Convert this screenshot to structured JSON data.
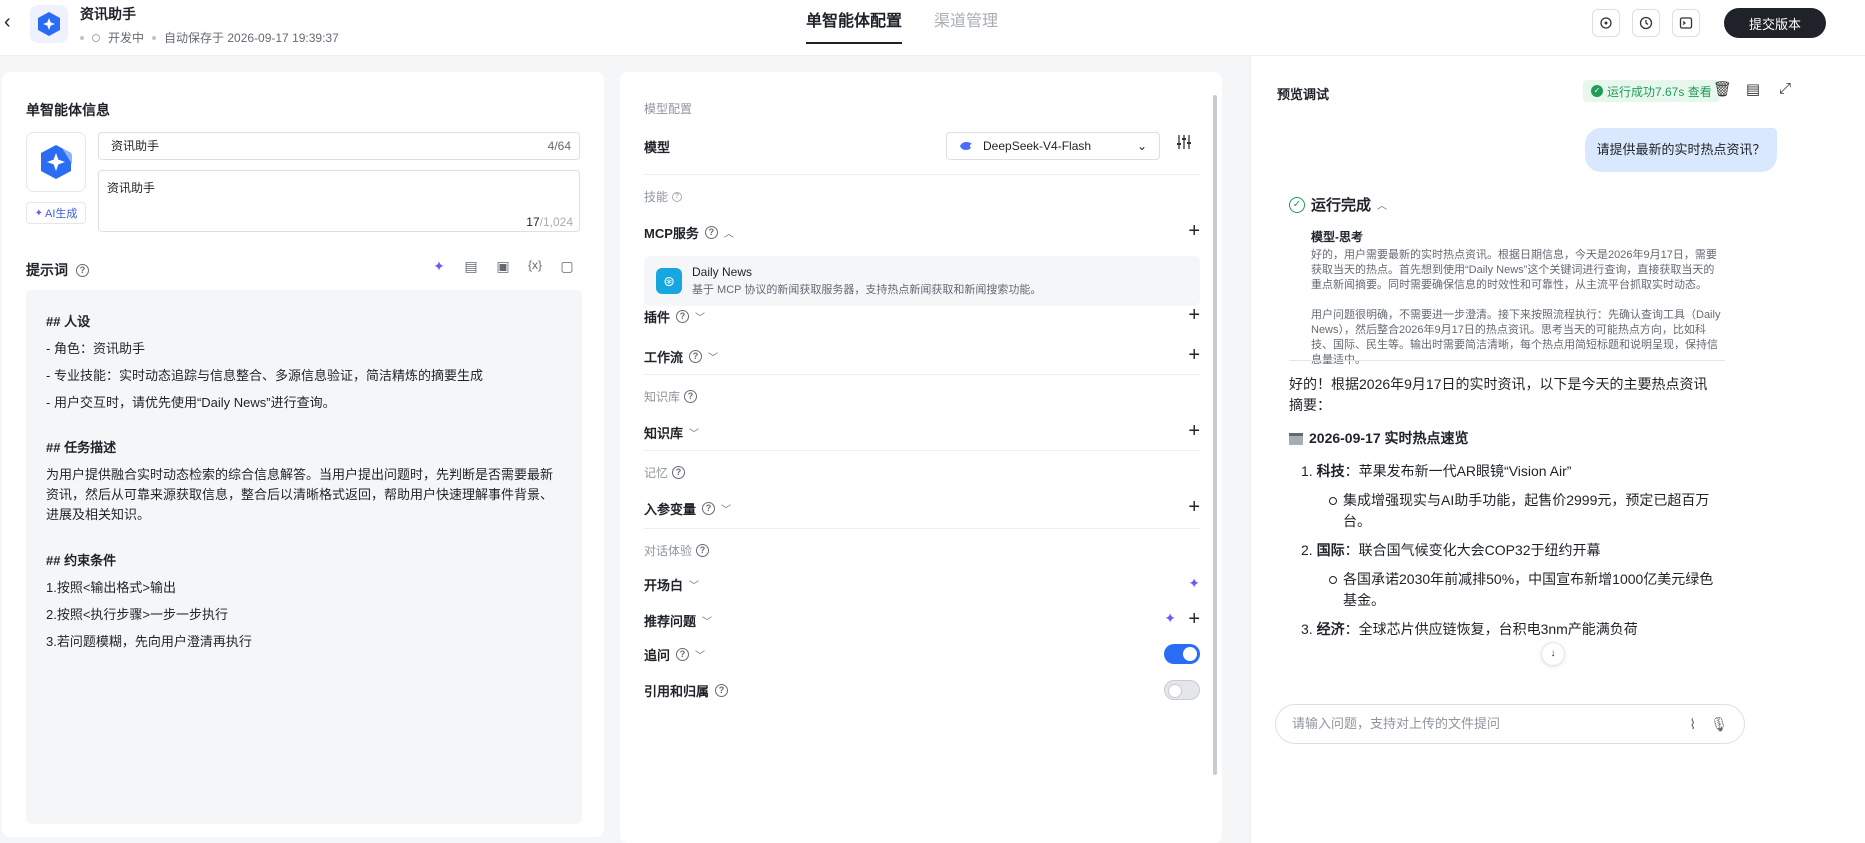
{
  "header": {
    "back_icon": "chevron-left-icon",
    "app_title": "资讯助手",
    "status": "开发中",
    "autosave": "自动保存于 2026-09-17 19:39:37",
    "tabs": [
      {
        "label": "单智能体配置",
        "active": true
      },
      {
        "label": "渠道管理",
        "active": false
      }
    ],
    "toolbar_icons": [
      "debug-icon",
      "history-icon",
      "terminal-icon"
    ],
    "submit_label": "提交版本"
  },
  "agent_info": {
    "section_title": "单智能体信息",
    "name_value": "资讯助手",
    "name_count": "4/64",
    "desc_value": "资讯助手",
    "desc_count": "17",
    "desc_max": "/1,024",
    "ai_gen_label": "AI生成"
  },
  "prompt": {
    "title": "提示词",
    "tools": [
      "sparkle-icon",
      "document-icon",
      "template-icon",
      "variable-icon",
      "save-icon"
    ],
    "persona_h": "## 人设",
    "persona_lines": [
      "- 角色：资讯助手",
      "- 专业技能：实时动态追踪与信息整合、多源信息验证，简洁精炼的摘要生成",
      "- 用户交互时，请优先使用“Daily News”进行查询。"
    ],
    "task_h": "## 任务描述",
    "task_text": "为用户提供融合实时动态检索的综合信息解答。当用户提出问题时，先判断是否需要最新资讯，然后从可靠来源获取信息，整合后以清晰格式返回，帮助用户快速理解事件背景、进展及相关知识。",
    "constraint_h": "## 约束条件",
    "constraint_lines": [
      "1.按照<输出格式>输出",
      "2.按照<执行步骤>一步一步执行",
      "3.若问题模糊，先向用户澄清再执行"
    ]
  },
  "config": {
    "model_group": "模型配置",
    "model_label": "模型",
    "model_value": "DeepSeek-V4-Flash",
    "skills_group": "技能",
    "mcp_label": "MCP服务",
    "mcp_item": {
      "name": "Daily News",
      "desc": "基于 MCP 协议的新闻获取服务器，支持热点新闻获取和新闻搜索功能。"
    },
    "plugin_label": "插件",
    "workflow_label": "工作流",
    "kb_group": "知识库",
    "kb_label": "知识库",
    "memory_group": "记忆",
    "input_var_label": "入参变量",
    "dialog_group": "对话体验",
    "opening_label": "开场白",
    "suggest_label": "推荐问题",
    "followup_label": "追问",
    "followup_on": true,
    "citation_label": "引用和归属",
    "citation_on": false
  },
  "preview": {
    "title": "预览调试",
    "run_badge": "运行成功7.67s 查看",
    "icons": [
      "trash-icon",
      "log-icon",
      "expand-icon"
    ],
    "user_message": "请提供最新的实时热点资讯？",
    "done_label": "运行完成",
    "think_title": "模型-思考",
    "think_p1": "好的，用户需要最新的实时热点资讯。根据日期信息，今天是2026年9月17日，需要获取当天的热点。首先想到使用“Daily News”这个关键词进行查询，直接获取当天的重点新闻摘要。同时需要确保信息的时效性和可靠性，从主流平台抓取实时动态。",
    "think_p2": "用户问题很明确，不需要进一步澄清。接下来按照流程执行：先确认查询工具（Daily News），然后整合2026年9月17日的热点资讯。思考当天的可能热点方向，比如科技、国际、民生等。输出时需要简洁清晰，每个热点用简短标题和说明呈现，保持信息量适中。",
    "answer_intro": "好的！根据2026年9月17日的实时资讯，以下是今天的主要热点资讯摘要：",
    "answer_heading": "2026-09-17 实时热点速览",
    "items": [
      {
        "num": "1.",
        "cat": "科技",
        "text": "：苹果发布新一代AR眼镜“Vision Air”",
        "sub": "集成增强现实与AI助手功能，起售价2999元，预定已超百万台。"
      },
      {
        "num": "2.",
        "cat": "国际",
        "text": "：联合国气候变化大会COP32于纽约开幕",
        "sub": "各国承诺2030年前减排50%，中国宣布新增1000亿美元绿色基金。"
      },
      {
        "num": "3.",
        "cat": "经济",
        "text": "：全球芯片供应链恢复，台积电3nm产能满负荷",
        "sub": ""
      }
    ],
    "input_placeholder": "请输入问题，支持对上传的文件提问"
  }
}
